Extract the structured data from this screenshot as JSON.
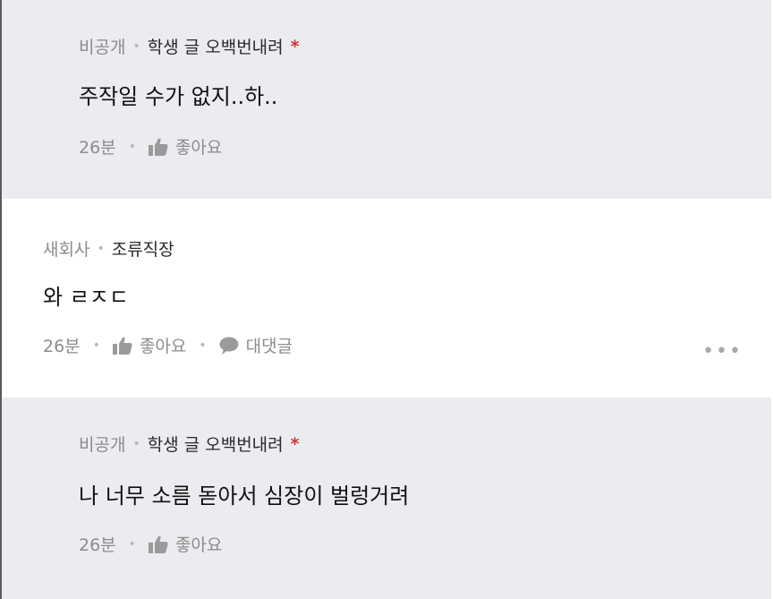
{
  "comments": [
    {
      "company": "비공개",
      "author": "학생 글 오백번내려",
      "op_marker": "*",
      "text": "주작일 수가 없지..하..",
      "time": "26분",
      "like_label": "좋아요"
    },
    {
      "company": "새회사",
      "author": "조류직장",
      "text": "와 ㄹㅈㄷ",
      "time": "26분",
      "like_label": "좋아요",
      "reply_label": "대댓글",
      "more_label": "•••"
    },
    {
      "company": "비공개",
      "author": "학생 글 오백번내려",
      "op_marker": "*",
      "text": "나 너무 소름 돋아서 심장이 벌렁거려",
      "time": "26분",
      "like_label": "좋아요"
    }
  ],
  "icons": {
    "like": "thumbs-up-icon",
    "reply": "speech-bubble-icon",
    "more": "more-dots-icon"
  },
  "colors": {
    "reply_background": "#ebecef",
    "op_marker": "#d4333a",
    "meta_text": "#8c8c8c"
  }
}
